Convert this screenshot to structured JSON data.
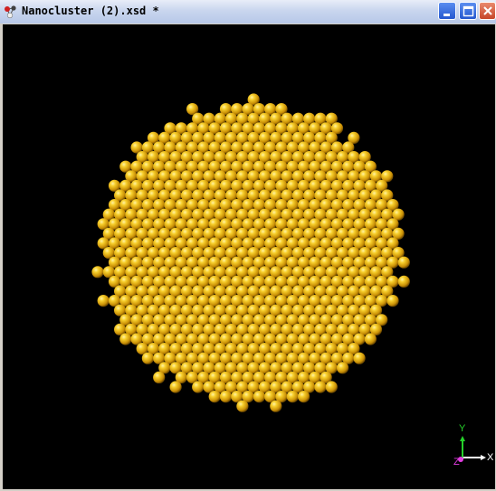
{
  "window": {
    "title": "Nanocluster (2).xsd *"
  },
  "viewport": {
    "background_color": "#000000",
    "atom_color": "#f2c21b",
    "cluster_shape": "disc-projected spherical nanocluster",
    "axes": {
      "x_label": "X",
      "y_label": "Y",
      "z_label": "Z",
      "x_color": "#ffffff",
      "y_color": "#25d02a",
      "z_color": "#e23de2"
    }
  },
  "icons": {
    "app": "molecule-icon",
    "minimize": "minimize-icon",
    "maximize": "maximize-icon",
    "close": "close-icon"
  }
}
